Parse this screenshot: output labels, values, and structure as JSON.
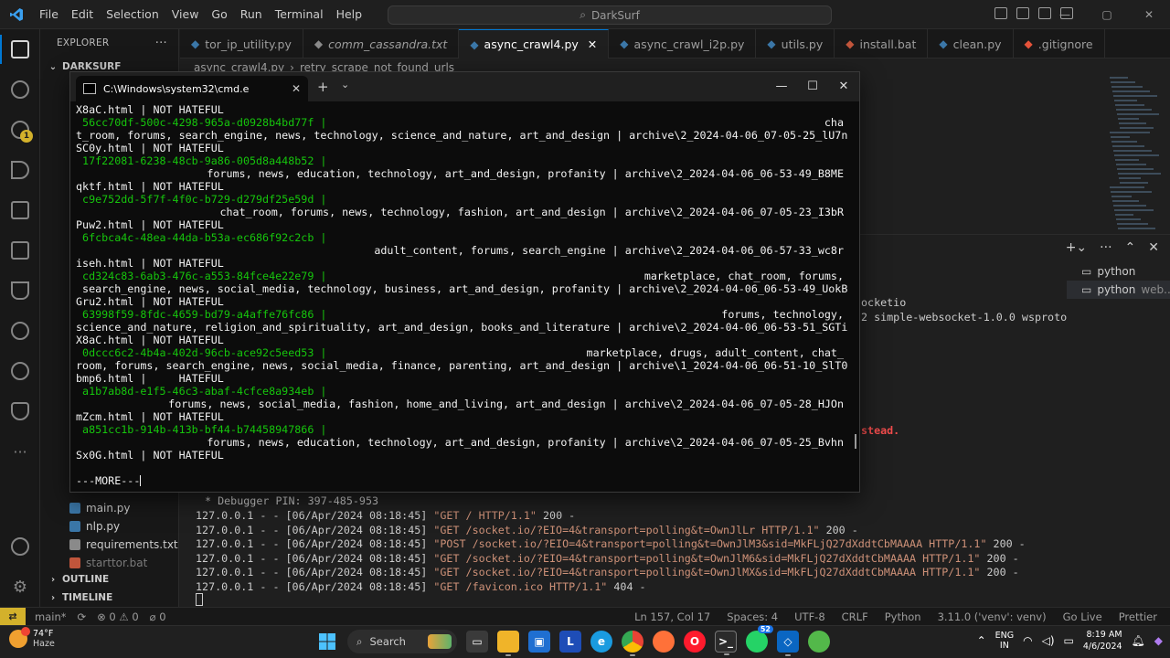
{
  "vscode": {
    "menu": [
      "File",
      "Edit",
      "Selection",
      "View",
      "Go",
      "Run",
      "Terminal",
      "Help"
    ],
    "search_placeholder": "DarkSurf",
    "sidebar": {
      "header": "EXPLORER",
      "folder": "DARKSURF",
      "files": [
        "main.py",
        "nlp.py",
        "requirements.txt",
        "starttor.bat"
      ],
      "outline": "OUTLINE",
      "timeline": "TIMELINE"
    },
    "tabs": [
      {
        "label": "tor_ip_utility.py",
        "italic": false
      },
      {
        "label": "comm_cassandra.txt",
        "italic": true
      },
      {
        "label": "async_crawl4.py",
        "italic": false,
        "active": true
      },
      {
        "label": "async_crawl_i2p.py",
        "italic": false
      },
      {
        "label": "utils.py",
        "italic": false
      },
      {
        "label": "install.bat",
        "italic": false
      },
      {
        "label": "clean.py",
        "italic": false
      },
      {
        "label": ".gitignore",
        "italic": false
      }
    ],
    "breadcrumb": {
      "file": "async_crawl4.py",
      "symbol": "retry_scrape_not_found_urls"
    },
    "panel": {
      "terminals": [
        {
          "name": "python",
          "detail": ""
        },
        {
          "name": "python",
          "detail": "web..."
        }
      ],
      "frag_socketio": "ocketio",
      "frag_websocket": "2 simple-websocket-1.0.0 wsproto",
      "frag_instead": "stead.",
      "debugger_pin": " * Debugger PIN: 397-485-953",
      "log": [
        {
          "prefix": "127.0.0.1 - - [06/Apr/2024 08:18:45] ",
          "req": "\"GET / HTTP/1.1\"",
          "code": " 200 -"
        },
        {
          "prefix": "127.0.0.1 - - [06/Apr/2024 08:18:45] ",
          "req": "\"GET /socket.io/?EIO=4&transport=polling&t=OwnJlLr HTTP/1.1\"",
          "code": " 200 -"
        },
        {
          "prefix": "127.0.0.1 - - [06/Apr/2024 08:18:45] ",
          "req": "\"POST /socket.io/?EIO=4&transport=polling&t=OwnJlM3&sid=MkFLjQ27dXddtCbMAAAA HTTP/1.1\"",
          "code": " 200 -"
        },
        {
          "prefix": "127.0.0.1 - - [06/Apr/2024 08:18:45] ",
          "req": "\"GET /socket.io/?EIO=4&transport=polling&t=OwnJlM6&sid=MkFLjQ27dXddtCbMAAAA HTTP/1.1\"",
          "code": " 200 -"
        },
        {
          "prefix": "127.0.0.1 - - [06/Apr/2024 08:18:45] ",
          "req": "\"GET /socket.io/?EIO=4&transport=polling&t=OwnJlMX&sid=MkFLjQ27dXddtCbMAAAA HTTP/1.1\"",
          "code": " 200 -"
        },
        {
          "prefix": "127.0.0.1 - - [06/Apr/2024 08:18:45] ",
          "req": "\"GET /favicon.ico HTTP/1.1\"",
          "code": " 404 -"
        }
      ]
    },
    "status": {
      "branch": "main*",
      "errors": "⊗ 0 ⚠ 0",
      "ports": "⌀ 0",
      "right": [
        "Ln 157, Col 17",
        "Spaces: 4",
        "UTF-8",
        "CRLF",
        "Python",
        "3.11.0 ('venv': venv)",
        "Go Live",
        "Prettier"
      ]
    }
  },
  "cmd": {
    "tab_title": "C:\\Windows\\system32\\cmd.e",
    "rows": [
      {
        "text": "X8aC.html | NOT HATEFUL",
        "kind": "text"
      },
      {
        "text": " 56cc70df-500c-4298-965a-d0928b4bd77f |",
        "kind": "uuid",
        "tail": "cha",
        "tailalign": "right"
      },
      {
        "text": "t_room, forums, search_engine, news, technology, science_and_nature, art_and_design | archive\\2_2024-04-06_07-05-25_lU7n",
        "kind": "text"
      },
      {
        "text": "SC0y.html | NOT HATEFUL",
        "kind": "text"
      },
      {
        "text": " 17f22081-6238-48cb-9a86-005d8a448b52 |",
        "kind": "uuid"
      },
      {
        "text": "forums, news, education, technology, art_and_design, profanity | archive\\2_2024-04-06_06-53-49_B8ME",
        "kind": "text",
        "align": "right"
      },
      {
        "text": "qktf.html | NOT HATEFUL",
        "kind": "text"
      },
      {
        "text": " c9e752dd-5f7f-4f0c-b729-d279df25e59d |",
        "kind": "uuid"
      },
      {
        "text": "chat_room, forums, news, technology, fashion, art_and_design | archive\\2_2024-04-06_07-05-23_I3bR",
        "kind": "text",
        "align": "right"
      },
      {
        "text": "Puw2.html | NOT HATEFUL",
        "kind": "text"
      },
      {
        "text": " 6fcbca4c-48ea-44da-b53a-ec686f92c2cb |",
        "kind": "uuid"
      },
      {
        "text": "adult_content, forums, search_engine | archive\\2_2024-04-06_06-57-33_wc8r",
        "kind": "text",
        "align": "right"
      },
      {
        "text": "iseh.html | NOT HATEFUL",
        "kind": "text"
      },
      {
        "text": " cd324c83-6ab3-476c-a553-84fce4e22e79 |",
        "kind": "uuid",
        "tail": "marketplace, chat_room, forums,",
        "tailalign": "right"
      },
      {
        "text": " search_engine, news, social_media, technology, business, art_and_design, profanity | archive\\2_2024-04-06_06-53-49_UokB",
        "kind": "text"
      },
      {
        "text": "Gru2.html | NOT HATEFUL",
        "kind": "text"
      },
      {
        "text": " 63998f59-8fdc-4659-bd79-a4affe76fc86 |",
        "kind": "uuid",
        "tail": "forums, technology,",
        "tailalign": "right"
      },
      {
        "text": "science_and_nature, religion_and_spirituality, art_and_design, books_and_literature | archive\\2_2024-04-06_06-53-51_SGTi",
        "kind": "text"
      },
      {
        "text": "X8aC.html | NOT HATEFUL",
        "kind": "text"
      },
      {
        "text": " 0dccc6c2-4b4a-402d-96cb-ace92c5eed53 |",
        "kind": "uuid",
        "tail": "marketplace, drugs, adult_content, chat_",
        "tailalign": "right"
      },
      {
        "text": "room, forums, search_engine, news, social_media, finance, parenting, art_and_design | archive\\1_2024-04-06_06-51-10_SlT0",
        "kind": "text"
      },
      {
        "text": "bmp6.html |     HATEFUL",
        "kind": "text"
      },
      {
        "text": " a1b7ab8d-e1f5-46c3-abaf-4cfce8a934eb |",
        "kind": "uuid"
      },
      {
        "text": "forums, news, social_media, fashion, home_and_living, art_and_design | archive\\2_2024-04-06_07-05-28_HJOn",
        "kind": "text",
        "align": "right"
      },
      {
        "text": "mZcm.html | NOT HATEFUL",
        "kind": "text"
      },
      {
        "text": " a851cc1b-914b-413b-bf44-b74458947866 |",
        "kind": "uuid"
      },
      {
        "text": "forums, news, education, technology, art_and_design, profanity | archive\\2_2024-04-06_07-05-25_Bvhn",
        "kind": "text",
        "align": "right"
      },
      {
        "text": "Sx0G.html | NOT HATEFUL",
        "kind": "text"
      },
      {
        "text": "",
        "kind": "text"
      },
      {
        "text": "---MORE---",
        "kind": "more"
      }
    ]
  },
  "taskbar": {
    "weather_temp": "74°F",
    "weather_desc": "Haze",
    "search_label": "Search",
    "lang_line1": "ENG",
    "lang_line2": "IN",
    "time": "8:19 AM",
    "date": "4/6/2024",
    "whatsapp_badge": "52"
  },
  "colors": {
    "uuid_green": "#16c60c",
    "accent_blue": "#0078d4",
    "remote_yellow": "#d3b12b",
    "string_orange": "#ce9178"
  }
}
